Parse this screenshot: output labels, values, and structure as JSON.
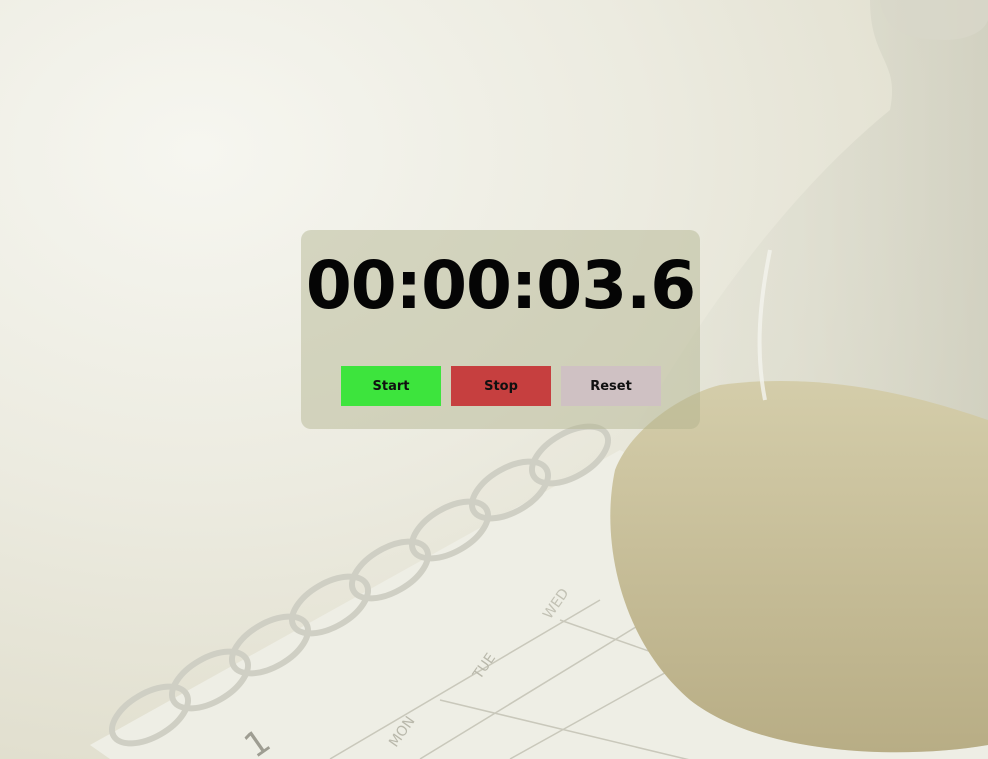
{
  "stopwatch": {
    "display": "00:00:03.6"
  },
  "controls": {
    "start_label": "Start",
    "stop_label": "Stop",
    "reset_label": "Reset"
  },
  "background": {
    "calendar_days": [
      "MON",
      "TUE",
      "WED"
    ],
    "calendar_number": "1"
  },
  "colors": {
    "start": "#3de43d",
    "stop": "#c63f3f",
    "reset": "#cfc1c3",
    "panel": "rgba(175,178,140,0.45)"
  }
}
